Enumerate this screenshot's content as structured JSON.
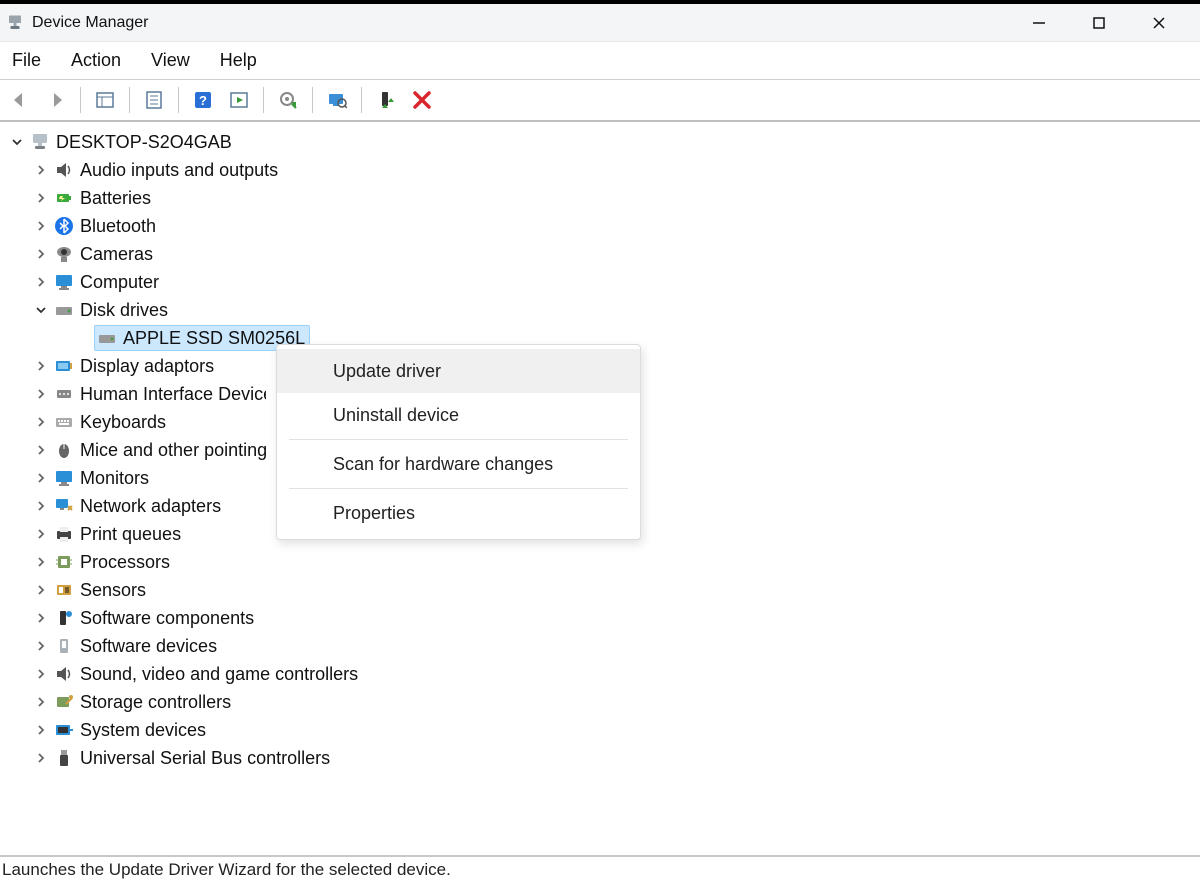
{
  "window": {
    "title": "Device Manager"
  },
  "menu": {
    "file": "File",
    "action": "Action",
    "view": "View",
    "help": "Help"
  },
  "tree": {
    "root": "DESKTOP-S2O4GAB",
    "audio": "Audio inputs and outputs",
    "batteries": "Batteries",
    "bluetooth": "Bluetooth",
    "cameras": "Cameras",
    "computer": "Computer",
    "diskdrives": "Disk drives",
    "disk_child": "APPLE SSD SM0256L",
    "display": "Display adaptors",
    "hid": "Human Interface Devices",
    "keyboards": "Keyboards",
    "mice": "Mice and other pointing devices",
    "monitors": "Monitors",
    "network": "Network adapters",
    "printqueues": "Print queues",
    "processors": "Processors",
    "sensors": "Sensors",
    "softcomp": "Software components",
    "softdev": "Software devices",
    "sound": "Sound, video and game controllers",
    "storage": "Storage controllers",
    "system": "System devices",
    "usb": "Universal Serial Bus controllers"
  },
  "context_menu": {
    "update": "Update driver",
    "uninstall": "Uninstall device",
    "scan": "Scan for hardware changes",
    "properties": "Properties"
  },
  "statusbar": {
    "text": "Launches the Update Driver Wizard for the selected device."
  }
}
